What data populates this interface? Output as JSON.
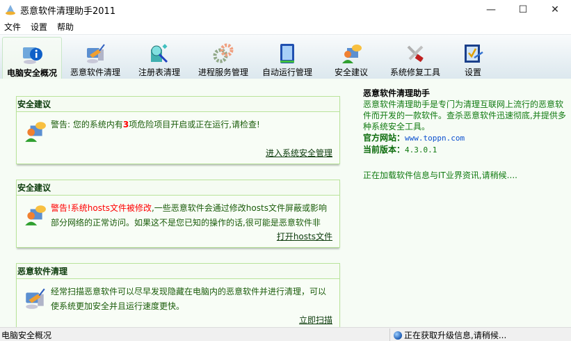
{
  "window": {
    "title": "恶意软件清理助手2011",
    "minimize": "—",
    "maximize": "☐",
    "close": "✕"
  },
  "menu": [
    "文件",
    "设置",
    "帮助"
  ],
  "tabs": [
    {
      "label": "电脑安全概况",
      "icon": "computer-info-icon",
      "active": true
    },
    {
      "label": "恶意软件清理",
      "icon": "computer-broom-icon"
    },
    {
      "label": "注册表清理",
      "icon": "registry-icon"
    },
    {
      "label": "进程服务管理",
      "icon": "gears-icon"
    },
    {
      "label": "自动运行管理",
      "icon": "startup-icon"
    },
    {
      "label": "安全建议",
      "icon": "advisor-icon"
    },
    {
      "label": "系统修复工具",
      "icon": "wrench-icon"
    },
    {
      "label": "设置",
      "icon": "settings-check-icon"
    }
  ],
  "panels": [
    {
      "title": "安全建议",
      "text_prefix": "警告: 您的系统内有",
      "count": "3",
      "text_suffix": "项危险项目开启或正在运行,请检查!",
      "link": "进入系统安全管理"
    },
    {
      "title": "安全建议",
      "warning": "警告!系统hosts文件被修改",
      "text": ",一些恶意软件会通过修改hosts文件屏蔽或影响部分网络的正常访问。如果这不是您已知的操作的话,很可能是恶意软件非",
      "link": "打开hosts文件"
    },
    {
      "title": "恶意软件清理",
      "text": "经常扫描恶意软件可以尽早发现隐藏在电脑内的恶意软件并进行清理，可以使系统更加安全并且运行速度更快。",
      "link": "立即扫描"
    }
  ],
  "info": {
    "heading": "恶意软件清理助手",
    "description": "恶意软件清理助手是专门为清理互联网上流行的恶意软件而开发的一款软件。查杀恶意软件迅速彻底,并提供多种系统安全工具。",
    "site_label": "官方网站：",
    "site": "www.toppn.com",
    "version_label": "当前版本：",
    "version": "4.3.0.1",
    "loading": "正在加载软件信息与IT业界资讯,请稍候...."
  },
  "status": {
    "left": "电脑安全概况",
    "right": "正在获取升级信息,请稍候..."
  }
}
